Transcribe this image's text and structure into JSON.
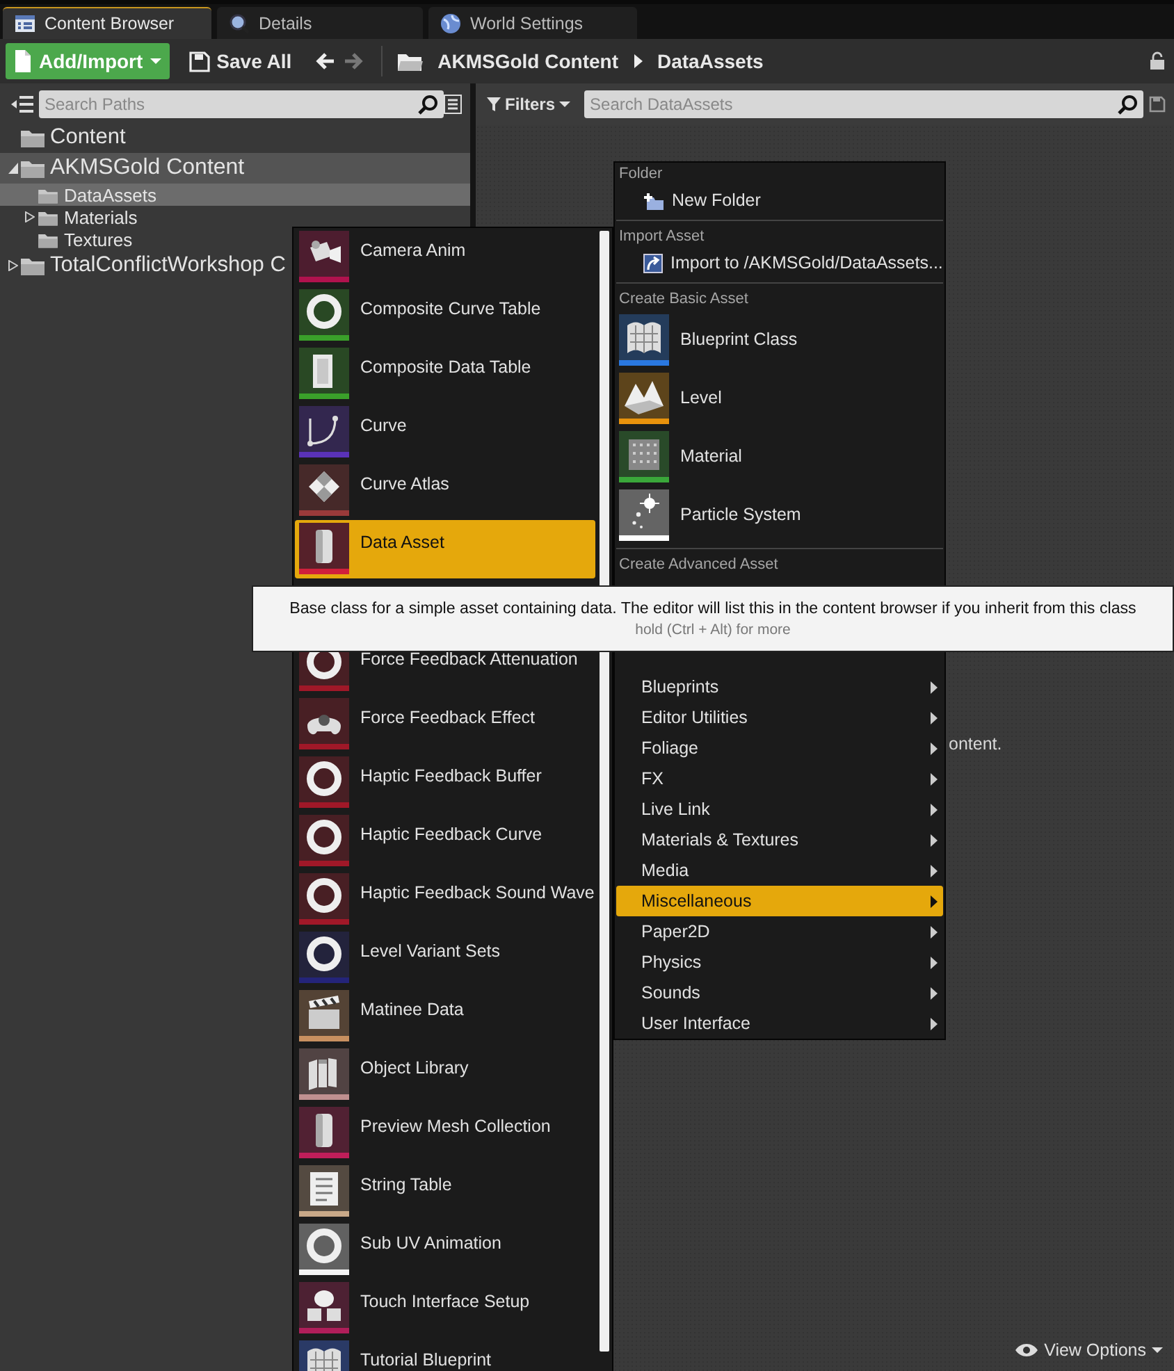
{
  "tabs": [
    {
      "label": "Content Browser",
      "kind": "browser",
      "selected": true
    },
    {
      "label": "Details",
      "kind": "details",
      "selected": false
    },
    {
      "label": "World Settings",
      "kind": "world",
      "selected": false
    }
  ],
  "toolbar": {
    "add_button": "Add/Import",
    "save_button": "Save All",
    "back_enabled": true,
    "forward_enabled": false,
    "breadcrumbs": [
      "AKMSGold Content",
      "DataAssets"
    ]
  },
  "sources": {
    "search": {
      "placeholder": "Search Paths"
    },
    "tree": [
      {
        "label": "Content",
        "highlighted": false,
        "selected": false
      },
      {
        "label": "AKMSGold Content",
        "expanded": true,
        "highlighted": true,
        "selected": false,
        "children": [
          {
            "label": "DataAssets",
            "highlighted": false,
            "selected": true
          },
          {
            "label": "Materials",
            "expanded": false,
            "highlighted": false,
            "selected": false
          },
          {
            "label": "Textures",
            "highlighted": false,
            "selected": false
          }
        ]
      },
      {
        "label": "TotalConflictWorkshop C",
        "expanded": false,
        "highlighted": false,
        "selected": false
      }
    ]
  },
  "content": {
    "filters_button": "Filters",
    "search": {
      "placeholder": "Search DataAssets"
    },
    "hint": "ontent.",
    "view_options": "View Options"
  },
  "context_menu": {
    "sections": [
      {
        "heading": "Folder",
        "items": [
          {
            "label": "New Folder",
            "kind": "new-folder"
          }
        ]
      },
      {
        "heading": "Import Asset",
        "items": [
          {
            "label": "Import to /AKMSGold/DataAssets...",
            "kind": "import"
          }
        ]
      },
      {
        "heading": "Create Basic Asset",
        "items": [
          {
            "label": "Blueprint Class",
            "kind": "sheet",
            "color": "#2a78e0"
          },
          {
            "label": "Level",
            "kind": "terrain",
            "color": "#e8920c"
          },
          {
            "label": "Material",
            "kind": "dots",
            "color": "#3aa83a"
          },
          {
            "label": "Particle System",
            "kind": "sparkle",
            "color": "#ffffff"
          }
        ]
      },
      {
        "heading": "Create Advanced Asset",
        "items": [
          {
            "label": "Blueprints",
            "kind": "submenu",
            "selected": false
          },
          {
            "label": "Editor Utilities",
            "kind": "submenu",
            "selected": false
          },
          {
            "label": "Foliage",
            "kind": "submenu",
            "selected": false
          },
          {
            "label": "FX",
            "kind": "submenu",
            "selected": false
          },
          {
            "label": "Live Link",
            "kind": "submenu",
            "selected": false
          },
          {
            "label": "Materials & Textures",
            "kind": "submenu",
            "selected": false
          },
          {
            "label": "Media",
            "kind": "submenu",
            "selected": false
          },
          {
            "label": "Miscellaneous",
            "kind": "submenu",
            "selected": true
          },
          {
            "label": "Paper2D",
            "kind": "submenu",
            "selected": false
          },
          {
            "label": "Physics",
            "kind": "submenu",
            "selected": false
          },
          {
            "label": "Sounds",
            "kind": "submenu",
            "selected": false
          },
          {
            "label": "User Interface",
            "kind": "submenu",
            "selected": false
          }
        ]
      }
    ]
  },
  "asset_menu": {
    "items": [
      {
        "label": "Camera Anim",
        "kind": "camera",
        "color": "#b0124e",
        "selected": false
      },
      {
        "label": "Composite Curve Table",
        "kind": "ring",
        "color": "#3aa02a",
        "selected": false
      },
      {
        "label": "Composite Data Table",
        "kind": "document",
        "color": "#3aa02a",
        "selected": false
      },
      {
        "label": "Curve",
        "kind": "curve",
        "color": "#5a32b8",
        "selected": false
      },
      {
        "label": "Curve Atlas",
        "kind": "checker",
        "color": "#9a3a3a",
        "selected": false
      },
      {
        "label": "Data Asset",
        "kind": "cylinder",
        "color": "#d0203c",
        "selected": true
      },
      {
        "label": "Force Feedback Attenuation",
        "kind": "ring",
        "color": "#a01828",
        "selected": false
      },
      {
        "label": "Force Feedback Effect",
        "kind": "gamepad",
        "color": "#a01828",
        "selected": false
      },
      {
        "label": "Haptic Feedback Buffer",
        "kind": "ring",
        "color": "#a01828",
        "selected": false
      },
      {
        "label": "Haptic Feedback Curve",
        "kind": "ring",
        "color": "#a01828",
        "selected": false
      },
      {
        "label": "Haptic Feedback Sound Wave",
        "kind": "ring",
        "color": "#a01828",
        "selected": false
      },
      {
        "label": "Level Variant Sets",
        "kind": "ring",
        "color": "#24247a",
        "selected": false
      },
      {
        "label": "Matinee Data",
        "kind": "clapper",
        "color": "#c89060",
        "selected": false
      },
      {
        "label": "Object Library",
        "kind": "books",
        "color": "#c09090",
        "selected": false
      },
      {
        "label": "Preview Mesh Collection",
        "kind": "cylinder",
        "color": "#c01e5a",
        "selected": false
      },
      {
        "label": "String Table",
        "kind": "list",
        "color": "#c8a888",
        "selected": false
      },
      {
        "label": "Sub UV Animation",
        "kind": "ring",
        "color": "#f4f4f4",
        "selected": false
      },
      {
        "label": "Touch Interface Setup",
        "kind": "pad",
        "color": "#b01e5a",
        "selected": false
      },
      {
        "label": "Tutorial Blueprint",
        "kind": "sheet",
        "selected": false
      }
    ]
  },
  "tooltip": {
    "text": "Base class for a simple asset containing data. The editor will list this in the content browser if you inherit from this class",
    "hint": "hold (Ctrl + Alt) for more"
  }
}
